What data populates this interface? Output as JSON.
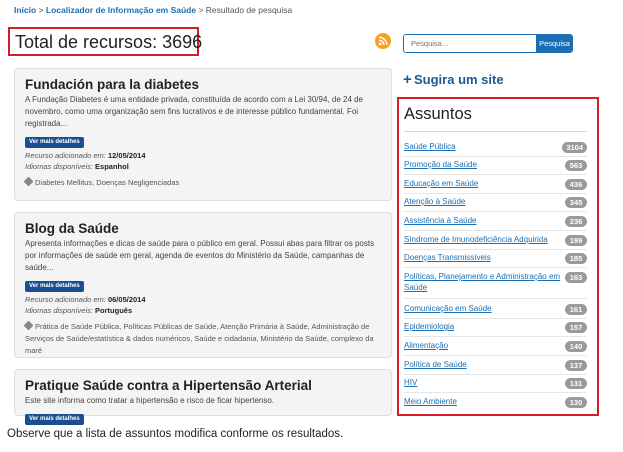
{
  "breadcrumb": {
    "home": "Início",
    "sep1": " > ",
    "locator": "Localizador de Informação em Saúde",
    "sep2": " > ",
    "current": "Resultado de pesquisa"
  },
  "total_label": "Total de recursos: 3696",
  "search": {
    "placeholder": "Pesquisa...",
    "button": "Pesquisa"
  },
  "suggest": {
    "icon": "+",
    "label": "Sugira um site"
  },
  "results": [
    {
      "title": "Fundación para la diabetes",
      "description": "A Fundação Diabetes é uma entidade privada, constituída de acordo com a Lei 30/94, de 24 de novembro, como uma organização sem fins lucrativos e de interesse público fundamental. Foi registrada...",
      "details_button": "Ver mais detalhes",
      "added_label": "Recurso adicionado em: ",
      "added_date": "12/05/2014",
      "languages_label": "Idiomas disponíveis: ",
      "languages": "Espanhol",
      "tags": "Diabetes Mellitus, Doenças Negligenciadas"
    },
    {
      "title": "Blog da Saúde",
      "description": "Apresenta informações e dicas de saúde para o público em geral. Possui abas para filtrar os posts por informações de saúde em geral, agenda de eventos do Ministério da Saúde, campanhas de saúde...",
      "details_button": "Ver mais detalhes",
      "added_label": "Recurso adicionado em: ",
      "added_date": "06/05/2014",
      "languages_label": "Idiomas disponíveis: ",
      "languages": "Português",
      "tags": "Prática de Saúde Pública, Políticas Públicas de Saúde, Atenção Primária à Saúde, Administração de Serviços de Saúde/estatística & dados numéricos, Saúde e cidadania, Ministério da Saúde, complexo da maré"
    },
    {
      "title": "Pratique Saúde contra a Hipertensão Arterial",
      "description": "Este site informa como tratar a hipertensão e risco de ficar hipertenso.",
      "details_button": "Ver mais detalhes"
    }
  ],
  "assuntos": {
    "title": "Assuntos",
    "items": [
      {
        "label": "Saúde Pública",
        "count": "3104"
      },
      {
        "label": "Promoção da Saúde",
        "count": "563"
      },
      {
        "label": "Educação em Saúde",
        "count": "436"
      },
      {
        "label": "Atenção à Saúde",
        "count": "345"
      },
      {
        "label": "Assistência à Saúde",
        "count": "236"
      },
      {
        "label": "Síndrome de Imunodeficiência Adquirida",
        "count": "199"
      },
      {
        "label": "Doenças Transmissíveis",
        "count": "185"
      },
      {
        "label": "Políticas, Planejamento e Administração em Saúde",
        "count": "163"
      },
      {
        "label": "Comunicação em Saúde",
        "count": "161"
      },
      {
        "label": "Epidemiologia",
        "count": "157"
      },
      {
        "label": "Alimentação",
        "count": "140"
      },
      {
        "label": "Política de Saúde",
        "count": "137"
      },
      {
        "label": "HIV",
        "count": "131"
      },
      {
        "label": "Meio Ambiente",
        "count": "130"
      }
    ]
  },
  "caption": "Observe que a lista de assuntos modifica conforme os resultados.",
  "colors": {
    "link": "#1a6fb5",
    "highlight_border": "#d81b24",
    "button": "#1a4f8f",
    "rss": "#f5a021"
  },
  "icons": {
    "rss": "rss-icon",
    "tag": "tag-icon",
    "plus": "plus-icon"
  }
}
